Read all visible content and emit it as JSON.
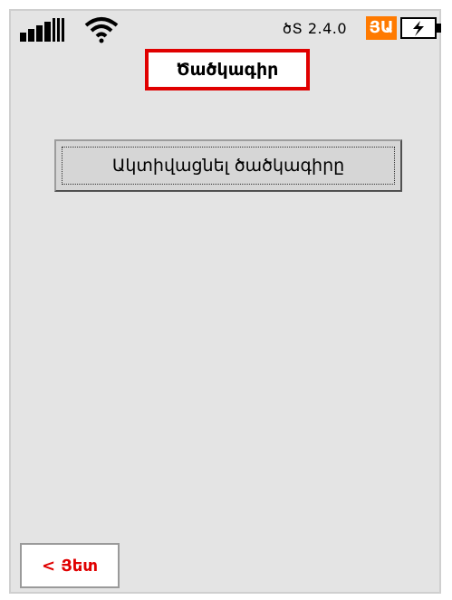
{
  "status_bar": {
    "os_version": "ծՏ 2.4.0",
    "language_badge": "ՅԱ",
    "signal_icon": "signal-bars-icon",
    "wifi_icon": "wifi-icon",
    "battery_icon": "battery-charging-icon",
    "badge_color": "#ff7a00"
  },
  "header": {
    "title": "Ծածկագիր",
    "title_border_color": "#e00000"
  },
  "main": {
    "activate_button_label": "Ակտիվացնել ծածկագիրը"
  },
  "footer": {
    "back_label": "< Յետ",
    "back_color": "#e00000"
  }
}
